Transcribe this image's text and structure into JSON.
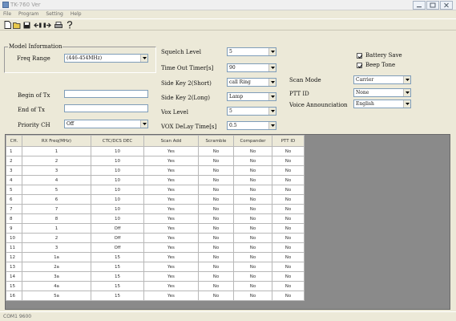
{
  "window": {
    "title": "TK-760 Ver",
    "min_icon": "minimize-icon",
    "max_icon": "maximize-icon",
    "close_icon": "close-icon"
  },
  "menu": [
    "File",
    "Program",
    "Setting",
    "Help"
  ],
  "toolbar": [
    "new-file-icon",
    "open-folder-icon",
    "save-disk-icon",
    "read-radio-icon",
    "write-radio-icon",
    "print-icon",
    "about-help-icon"
  ],
  "model_info": {
    "group_title": "Model Information",
    "freq_range_label": "Freq Range",
    "freq_range_value": "(446-454MHz)"
  },
  "text_fields": {
    "begin_of_tx_label": "Begin of Tx",
    "begin_of_tx_value": "",
    "end_of_tx_label": "End of Tx",
    "end_of_tx_value": "",
    "priority_ch_label": "Priority CH",
    "priority_ch_value": "Off"
  },
  "settings": {
    "squelch_label": "Squelch Level",
    "squelch_value": "5",
    "tot_label": "Time Out Timer[s]",
    "tot_value": "90",
    "sidekey_short_label": "Side Key 2(Short)",
    "sidekey_short_value": "call Ring",
    "sidekey_long_label": "Side Key 2(Long)",
    "sidekey_long_value": "Lamp",
    "vox_label": "Vox Level",
    "vox_value": "5",
    "vox_delay_label": "VOX DeLay Time[s]",
    "vox_delay_value": "0.5"
  },
  "right": {
    "battery_save_label": "Battery Save",
    "battery_save_checked": true,
    "beep_tone_label": "Beep Tone",
    "beep_tone_checked": true,
    "scan_mode_label": "Scan Mode",
    "scan_mode_value": "Carrier",
    "ptt_id_label": "PTT ID",
    "ptt_id_value": "None",
    "voice_label": "Voice Announciation",
    "voice_value": "English"
  },
  "table": {
    "headers": [
      "CH.",
      "RX Freq(MHz)",
      "CTC/DCS DEC",
      "Scan Add",
      "Scramble",
      "Compander",
      "PTT ID"
    ],
    "rows": [
      [
        "1",
        "1",
        "10",
        "Yes",
        "No",
        "No",
        "No"
      ],
      [
        "2",
        "2",
        "10",
        "Yes",
        "No",
        "No",
        "No"
      ],
      [
        "3",
        "3",
        "10",
        "Yes",
        "No",
        "No",
        "No"
      ],
      [
        "4",
        "4",
        "10",
        "Yes",
        "No",
        "No",
        "No"
      ],
      [
        "5",
        "5",
        "10",
        "Yes",
        "No",
        "No",
        "No"
      ],
      [
        "6",
        "6",
        "10",
        "Yes",
        "No",
        "No",
        "No"
      ],
      [
        "7",
        "7",
        "10",
        "Yes",
        "No",
        "No",
        "No"
      ],
      [
        "8",
        "8",
        "10",
        "Yes",
        "No",
        "No",
        "No"
      ],
      [
        "9",
        "1",
        "Off",
        "Yes",
        "No",
        "No",
        "No"
      ],
      [
        "10",
        "2",
        "Off",
        "Yes",
        "No",
        "No",
        "No"
      ],
      [
        "11",
        "3",
        "Off",
        "Yes",
        "No",
        "No",
        "No"
      ],
      [
        "12",
        "1a",
        "15",
        "Yes",
        "No",
        "No",
        "No"
      ],
      [
        "13",
        "2a",
        "15",
        "Yes",
        "No",
        "No",
        "No"
      ],
      [
        "14",
        "3a",
        "15",
        "Yes",
        "No",
        "No",
        "No"
      ],
      [
        "15",
        "4a",
        "15",
        "Yes",
        "No",
        "No",
        "No"
      ],
      [
        "16",
        "5a",
        "15",
        "Yes",
        "No",
        "No",
        "No"
      ]
    ]
  },
  "status": {
    "text": "COM1 9600"
  }
}
